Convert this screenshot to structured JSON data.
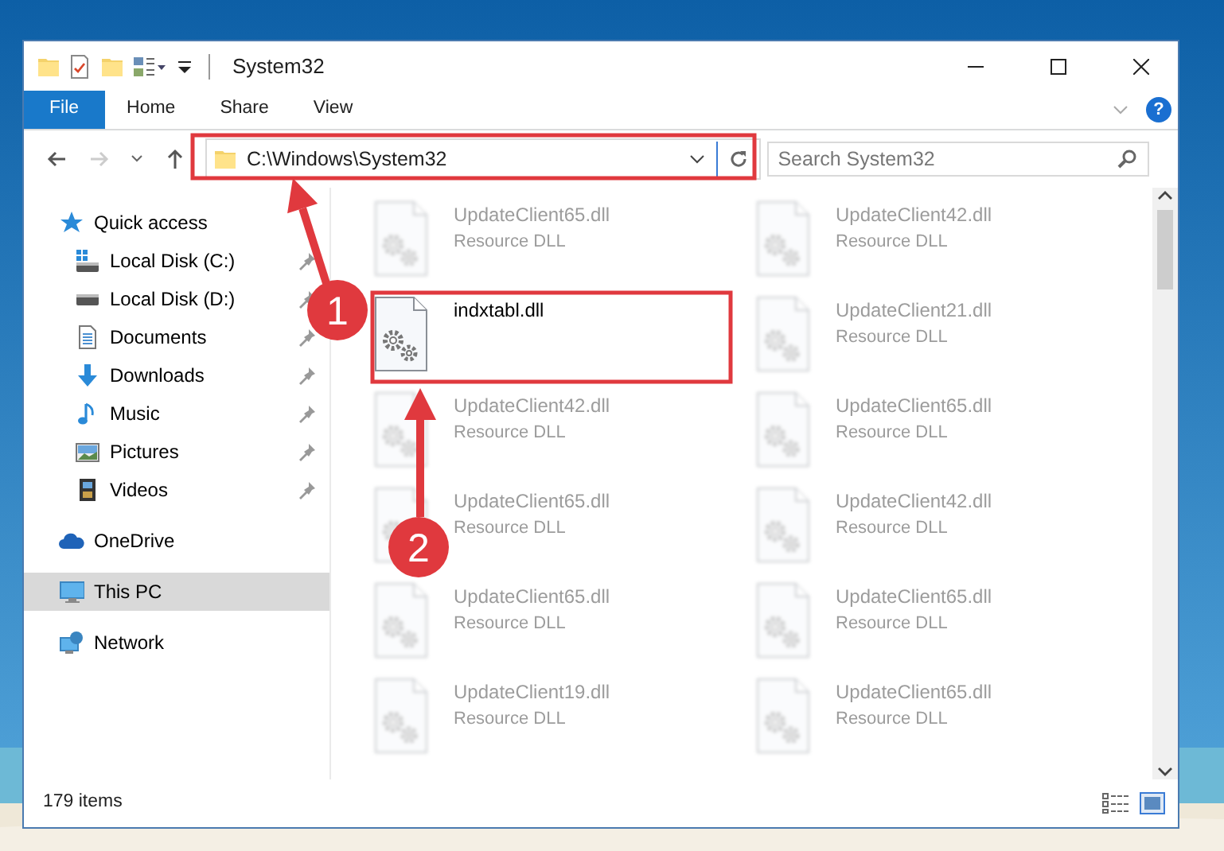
{
  "window": {
    "title": "System32"
  },
  "ribbon": {
    "tabs": [
      {
        "label": "File",
        "selected": true
      },
      {
        "label": "Home",
        "selected": false
      },
      {
        "label": "Share",
        "selected": false
      },
      {
        "label": "View",
        "selected": false
      }
    ],
    "help": "?"
  },
  "address": {
    "path": "C:\\Windows\\System32"
  },
  "search": {
    "placeholder": "Search System32"
  },
  "sidebar": {
    "items": [
      {
        "label": "Quick access",
        "kind": "quick-access",
        "selected": false,
        "children": [
          {
            "label": "Local Disk (C:)",
            "kind": "system-drive",
            "pinned": true,
            "selected": false
          },
          {
            "label": "Local Disk (D:)",
            "kind": "drive",
            "pinned": true,
            "selected": false
          },
          {
            "label": "Documents",
            "kind": "documents",
            "pinned": true,
            "selected": false
          },
          {
            "label": "Downloads",
            "kind": "downloads",
            "pinned": true,
            "selected": false
          },
          {
            "label": "Music",
            "kind": "music",
            "pinned": true,
            "selected": false
          },
          {
            "label": "Pictures",
            "kind": "pictures",
            "pinned": true,
            "selected": false
          },
          {
            "label": "Videos",
            "kind": "videos",
            "pinned": true,
            "selected": false
          }
        ]
      },
      {
        "label": "OneDrive",
        "kind": "cloud",
        "selected": false
      },
      {
        "label": "This PC",
        "kind": "computer",
        "selected": true
      },
      {
        "label": "Network",
        "kind": "network",
        "selected": false
      }
    ]
  },
  "files": [
    {
      "name": "UpdateClient65.dll",
      "type": "Resource DLL",
      "blurred": true
    },
    {
      "name": "UpdateClient42.dll",
      "type": "Resource DLL",
      "blurred": true
    },
    {
      "name": "indxtabl.dll",
      "blurred": false
    },
    {
      "name": "UpdateClient21.dll",
      "type": "Resource DLL",
      "blurred": true
    },
    {
      "name": "UpdateClient42.dll",
      "type": "Resource DLL",
      "blurred": true
    },
    {
      "name": "UpdateClient65.dll",
      "type": "Resource DLL",
      "blurred": true
    },
    {
      "name": "UpdateClient65.dll",
      "type": "Resource DLL",
      "blurred": true
    },
    {
      "name": "UpdateClient42.dll",
      "type": "Resource DLL",
      "blurred": true
    },
    {
      "name": "UpdateClient65.dll",
      "type": "Resource DLL",
      "blurred": true
    },
    {
      "name": "UpdateClient65.dll",
      "type": "Resource DLL",
      "blurred": true
    },
    {
      "name": "UpdateClient19.dll",
      "type": "Resource DLL",
      "blurred": true
    },
    {
      "name": "UpdateClient65.dll",
      "type": "Resource DLL",
      "blurred": true
    }
  ],
  "annotations": [
    {
      "number": "1"
    },
    {
      "number": "2"
    }
  ],
  "status_bar": {
    "count": "179 items"
  }
}
